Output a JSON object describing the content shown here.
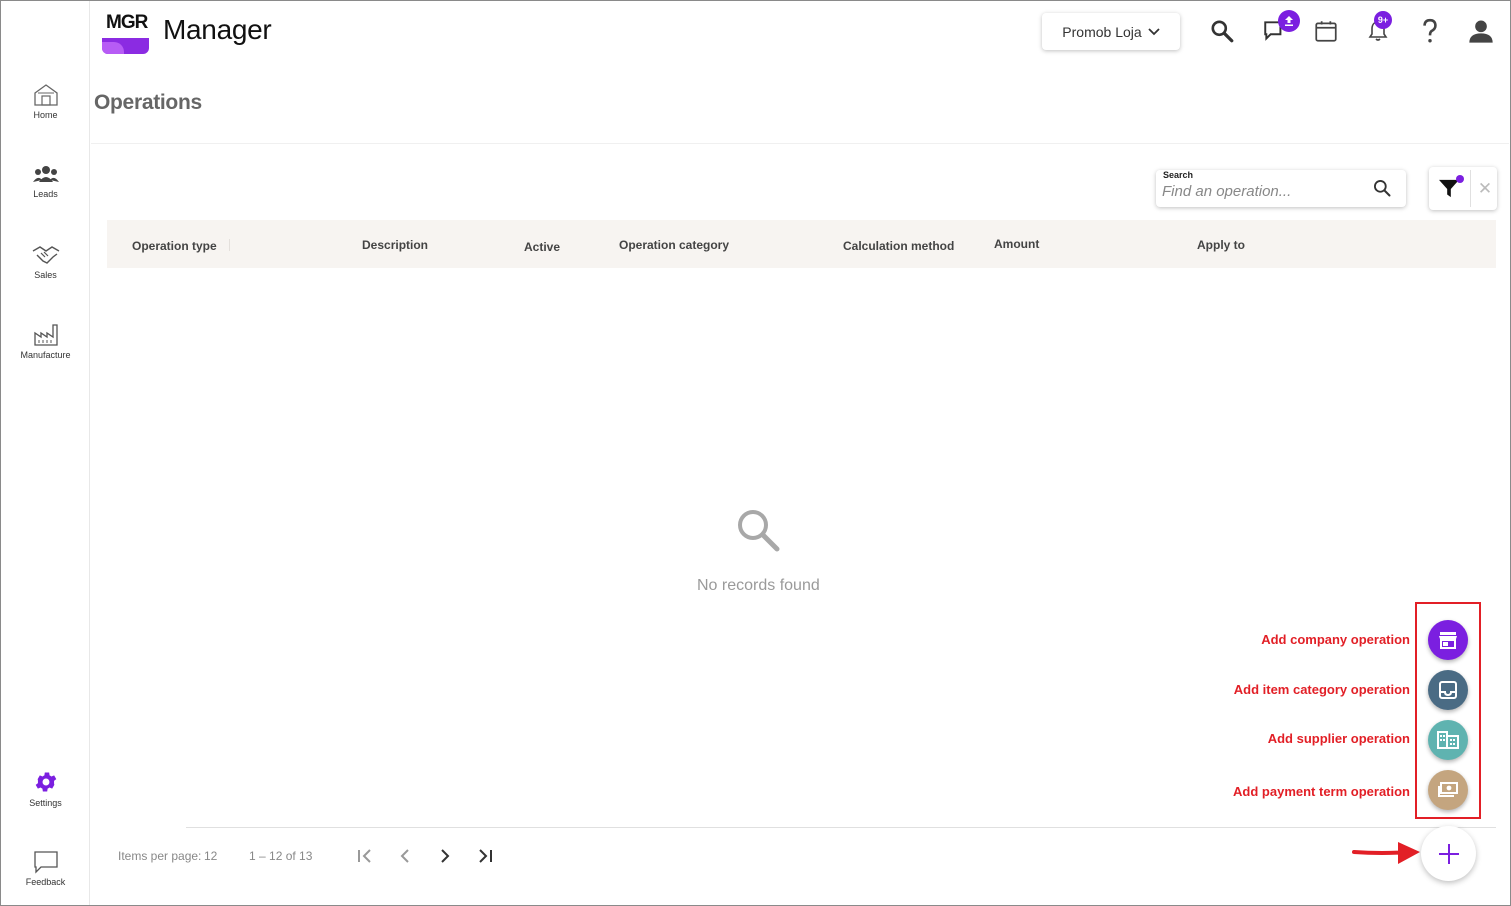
{
  "app": {
    "logo_text": "MGR",
    "title": "Manager",
    "store_selector": "Promob Loja",
    "notification_badge": "9+"
  },
  "sidebar": {
    "items": [
      {
        "label": "Home",
        "icon": "home-icon"
      },
      {
        "label": "Leads",
        "icon": "people-icon"
      },
      {
        "label": "Sales",
        "icon": "handshake-icon"
      },
      {
        "label": "Manufacture",
        "icon": "factory-icon"
      }
    ],
    "bottom_items": [
      {
        "label": "Settings",
        "icon": "gear-icon"
      },
      {
        "label": "Feedback",
        "icon": "chat-bubble-icon"
      }
    ]
  },
  "page": {
    "title": "Operations"
  },
  "search": {
    "label": "Search",
    "placeholder": "Find an operation..."
  },
  "table": {
    "columns": [
      "Operation type",
      "Description",
      "Active",
      "Operation category",
      "Calculation method",
      "Amount",
      "Apply to"
    ],
    "empty_text": "No records found"
  },
  "pagination": {
    "items_per_page_label": "Items per page:",
    "items_per_page_value": "12",
    "range_text": "1 – 12 of 13"
  },
  "fab_actions": [
    {
      "label": "Add company operation",
      "icon": "storefront-icon",
      "color": "#7b1fe0"
    },
    {
      "label": "Add item category operation",
      "icon": "inbox-icon",
      "color": "#4a6b84"
    },
    {
      "label": "Add supplier operation",
      "icon": "building-icon",
      "color": "#5fb3b0"
    },
    {
      "label": "Add payment term operation",
      "icon": "money-icon",
      "color": "#c4a57f"
    }
  ],
  "colors": {
    "accent": "#7b1fe0",
    "annotation": "#e21f26"
  }
}
